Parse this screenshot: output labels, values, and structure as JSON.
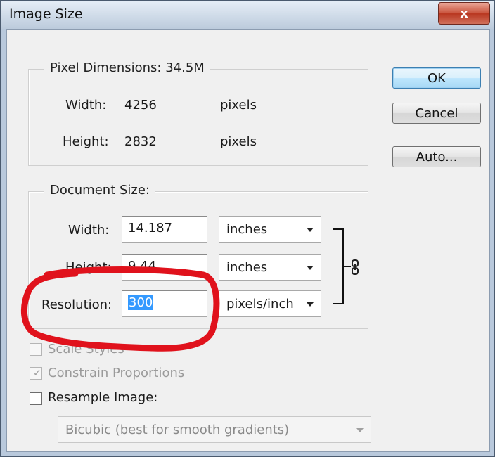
{
  "window": {
    "title": "Image Size",
    "close_glyph": "x"
  },
  "pixel_dimensions": {
    "title": "Pixel Dimensions:",
    "size": "34.5M",
    "width_label": "Width:",
    "width_value": "4256",
    "width_unit": "pixels",
    "height_label": "Height:",
    "height_value": "2832",
    "height_unit": "pixels"
  },
  "document_size": {
    "title": "Document Size:",
    "width_label": "Width:",
    "width_value": "14.187",
    "width_unit": "inches",
    "height_label": "Height:",
    "height_value": "9.44",
    "height_unit": "inches",
    "resolution_label": "Resolution:",
    "resolution_value": "300",
    "resolution_unit": "pixels/inch",
    "link_icon": "chain-link-icon"
  },
  "buttons": {
    "ok": "OK",
    "cancel": "Cancel",
    "auto": "Auto..."
  },
  "options": {
    "scale_styles": {
      "label": "Scale Styles",
      "checked": false,
      "enabled": false
    },
    "constrain_proportions": {
      "label": "Constrain Proportions",
      "checked": true,
      "enabled": false
    },
    "resample_image": {
      "label": "Resample Image:",
      "checked": false,
      "enabled": true
    },
    "resample_method": "Bicubic (best for smooth gradients)"
  },
  "colors": {
    "highlight_annotation": "#e0121c",
    "selection": "#3399ff",
    "default_button": "#3c7fb1"
  }
}
